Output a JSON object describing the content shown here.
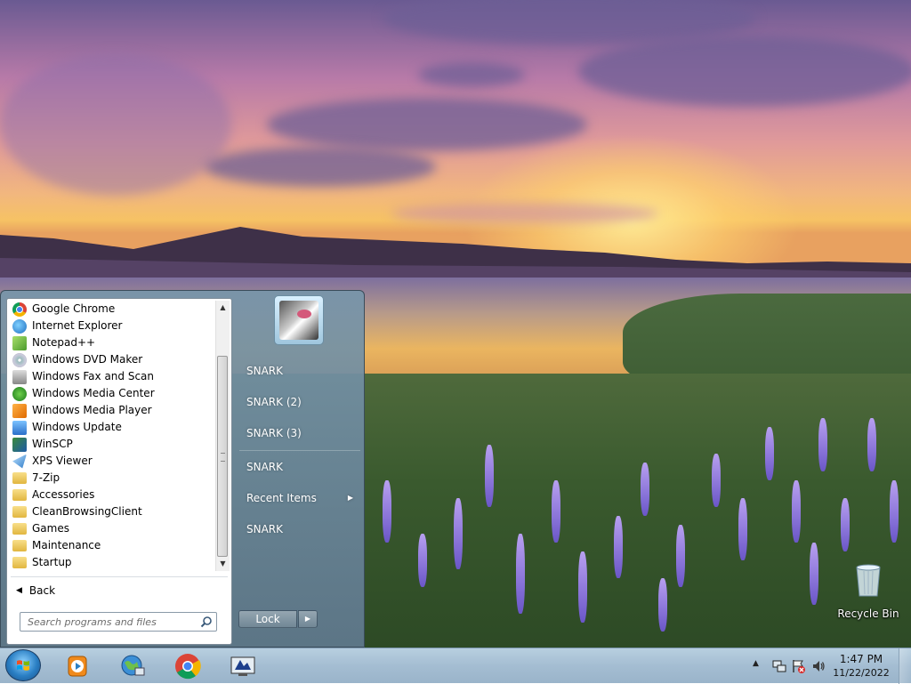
{
  "start_menu": {
    "programs": [
      {
        "label": "Google Chrome",
        "icon": "chrome-icon"
      },
      {
        "label": "Internet Explorer",
        "icon": "internet-explorer-icon"
      },
      {
        "label": "Notepad++",
        "icon": "notepad-plus-plus-icon"
      },
      {
        "label": "Windows DVD Maker",
        "icon": "dvd-maker-icon"
      },
      {
        "label": "Windows Fax and Scan",
        "icon": "fax-scan-icon"
      },
      {
        "label": "Windows Media Center",
        "icon": "media-center-icon"
      },
      {
        "label": "Windows Media Player",
        "icon": "media-player-icon"
      },
      {
        "label": "Windows Update",
        "icon": "windows-update-icon"
      },
      {
        "label": "WinSCP",
        "icon": "winscp-icon"
      },
      {
        "label": "XPS Viewer",
        "icon": "xps-viewer-icon"
      },
      {
        "label": "7-Zip",
        "icon": "folder-icon"
      },
      {
        "label": "Accessories",
        "icon": "folder-icon"
      },
      {
        "label": "CleanBrowsingClient",
        "icon": "folder-icon"
      },
      {
        "label": "Games",
        "icon": "folder-icon"
      },
      {
        "label": "Maintenance",
        "icon": "folder-icon"
      },
      {
        "label": "Startup",
        "icon": "folder-icon"
      }
    ],
    "back_label": "Back",
    "search_placeholder": "Search programs and files",
    "right_items": [
      "SNARK",
      "SNARK (2)",
      "SNARK (3)",
      "SNARK",
      "Recent Items",
      "SNARK"
    ],
    "lock_label": "Lock"
  },
  "desktop": {
    "recycle_bin_label": "Recycle Bin"
  },
  "taskbar": {
    "pinned": [
      {
        "name": "windows-media-player-taskbar-button",
        "icon": "media-player-icon"
      },
      {
        "name": "network-taskbar-button",
        "icon": "network-globe-icon"
      },
      {
        "name": "chrome-taskbar-button",
        "icon": "chrome-icon"
      },
      {
        "name": "remote-desktop-taskbar-button",
        "icon": "remote-desktop-icon"
      }
    ],
    "clock_time": "1:47 PM",
    "clock_date": "11/22/2022"
  },
  "colors": {
    "taskbar": "#a4bdd2",
    "start_menu_glass": "#6f8ea3",
    "accent_blue": "#2a7fc4"
  }
}
